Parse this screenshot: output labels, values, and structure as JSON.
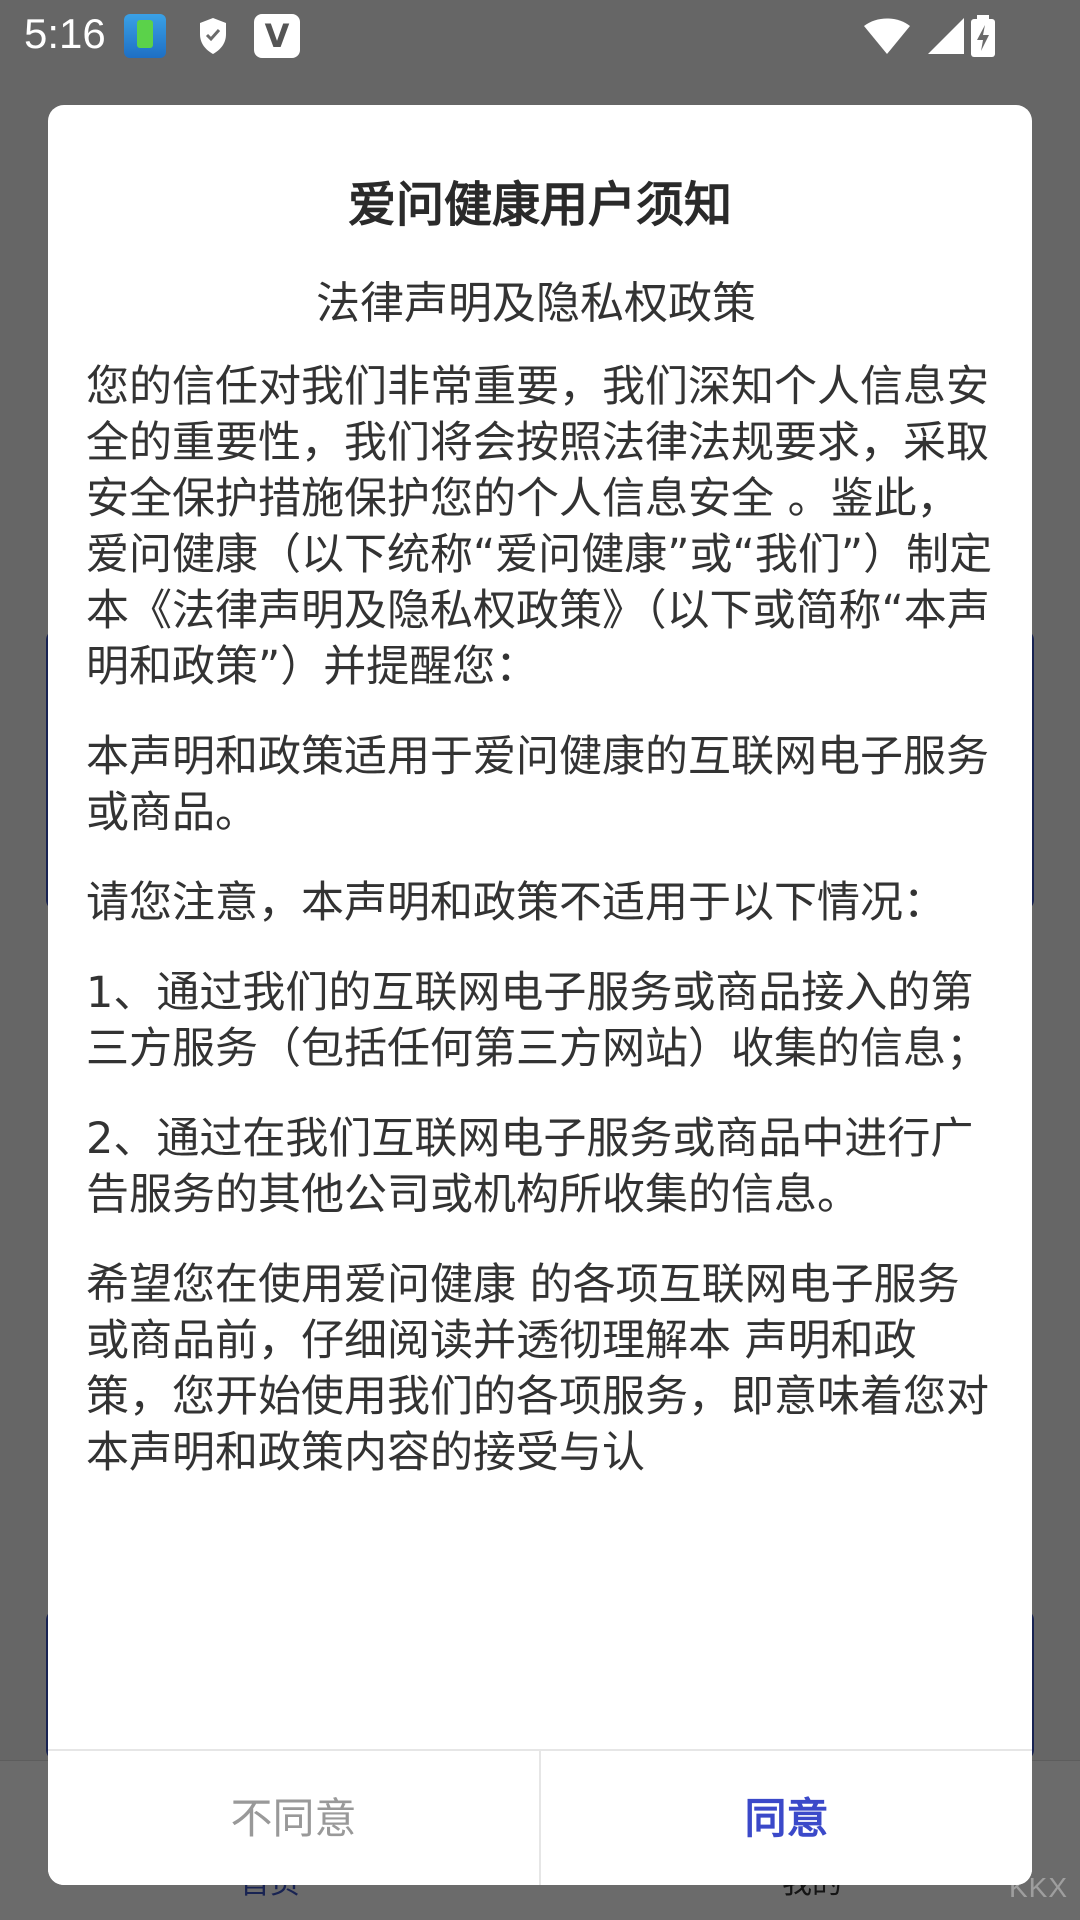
{
  "status_bar": {
    "time": "5:16",
    "app_letter": "V"
  },
  "background_app": {
    "tab_home": "首页",
    "tab_mine": "我的"
  },
  "dialog": {
    "title": "爱问健康用户须知",
    "heading": "法律声明及隐私权政策",
    "paragraphs": [
      "您的信任对我们非常重要，我们深知个人信息安全的重要性，我们将会按照法律法规要求，采取安全保护措施保护您的个人信息安全 。鉴此，爱问健康（以下统称“爱问健康”或“我们”）制定本《法律声明及隐私权政策》（以下或简称“本声明和政策”）并提醒您：",
      "本声明和政策适用于爱问健康的互联网电子服务或商品。",
      "请您注意，本声明和政策不适用于以下情况：",
      "1、通过我们的互联网电子服务或商品接入的第三方服务（包括任何第三方网站）收集的信息；",
      "2、通过在我们互联网电子服务或商品中进行广告服务的其他公司或机构所收集的信息。",
      "希望您在使用爱问健康 的各项互联网电子服务或商品前，仔细阅读并透彻理解本 声明和政策，您开始使用我们的各项服务，即意味着您对本声明和政策内容的接受与认"
    ],
    "disagree_label": "不同意",
    "agree_label": "同意"
  },
  "watermark": "KKX"
}
